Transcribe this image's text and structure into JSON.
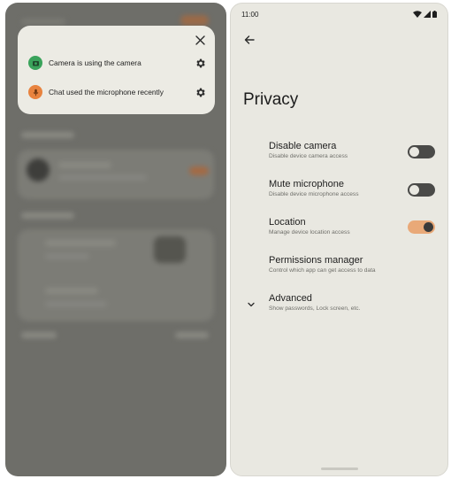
{
  "left_phone": {
    "popup": {
      "close_icon": "close-icon",
      "items": [
        {
          "text": "Camera is using the camera",
          "icon": "camera-icon",
          "color": "#3aa35b",
          "action_icon": "gear-icon"
        },
        {
          "text": "Chat used the microphone recently",
          "icon": "microphone-icon",
          "color": "#e8833f",
          "action_icon": "gear-icon"
        }
      ]
    }
  },
  "right_phone": {
    "status_bar": {
      "time": "11:00",
      "icons": [
        "wifi-icon",
        "signal-icon",
        "battery-icon"
      ]
    },
    "back_icon": "arrow-back-icon",
    "title": "Privacy",
    "settings": [
      {
        "title": "Disable camera",
        "subtitle": "Disable device camera access",
        "toggle": false
      },
      {
        "title": "Mute microphone",
        "subtitle": "Disable device microphone access",
        "toggle": false
      },
      {
        "title": "Location",
        "subtitle": "Manage device location access",
        "toggle": true
      },
      {
        "title": "Permissions manager",
        "subtitle": "Control which app can get access to data"
      },
      {
        "title": "Advanced",
        "subtitle": "Show passwords, Lock screen, etc.",
        "icon": "chevron-down-icon"
      }
    ],
    "colors": {
      "toggle_on_track": "#e9a978",
      "toggle_on_knob": "#3a3a3a",
      "toggle_off_track": "#4a4a48",
      "toggle_off_knob": "#e9e8e1"
    }
  }
}
